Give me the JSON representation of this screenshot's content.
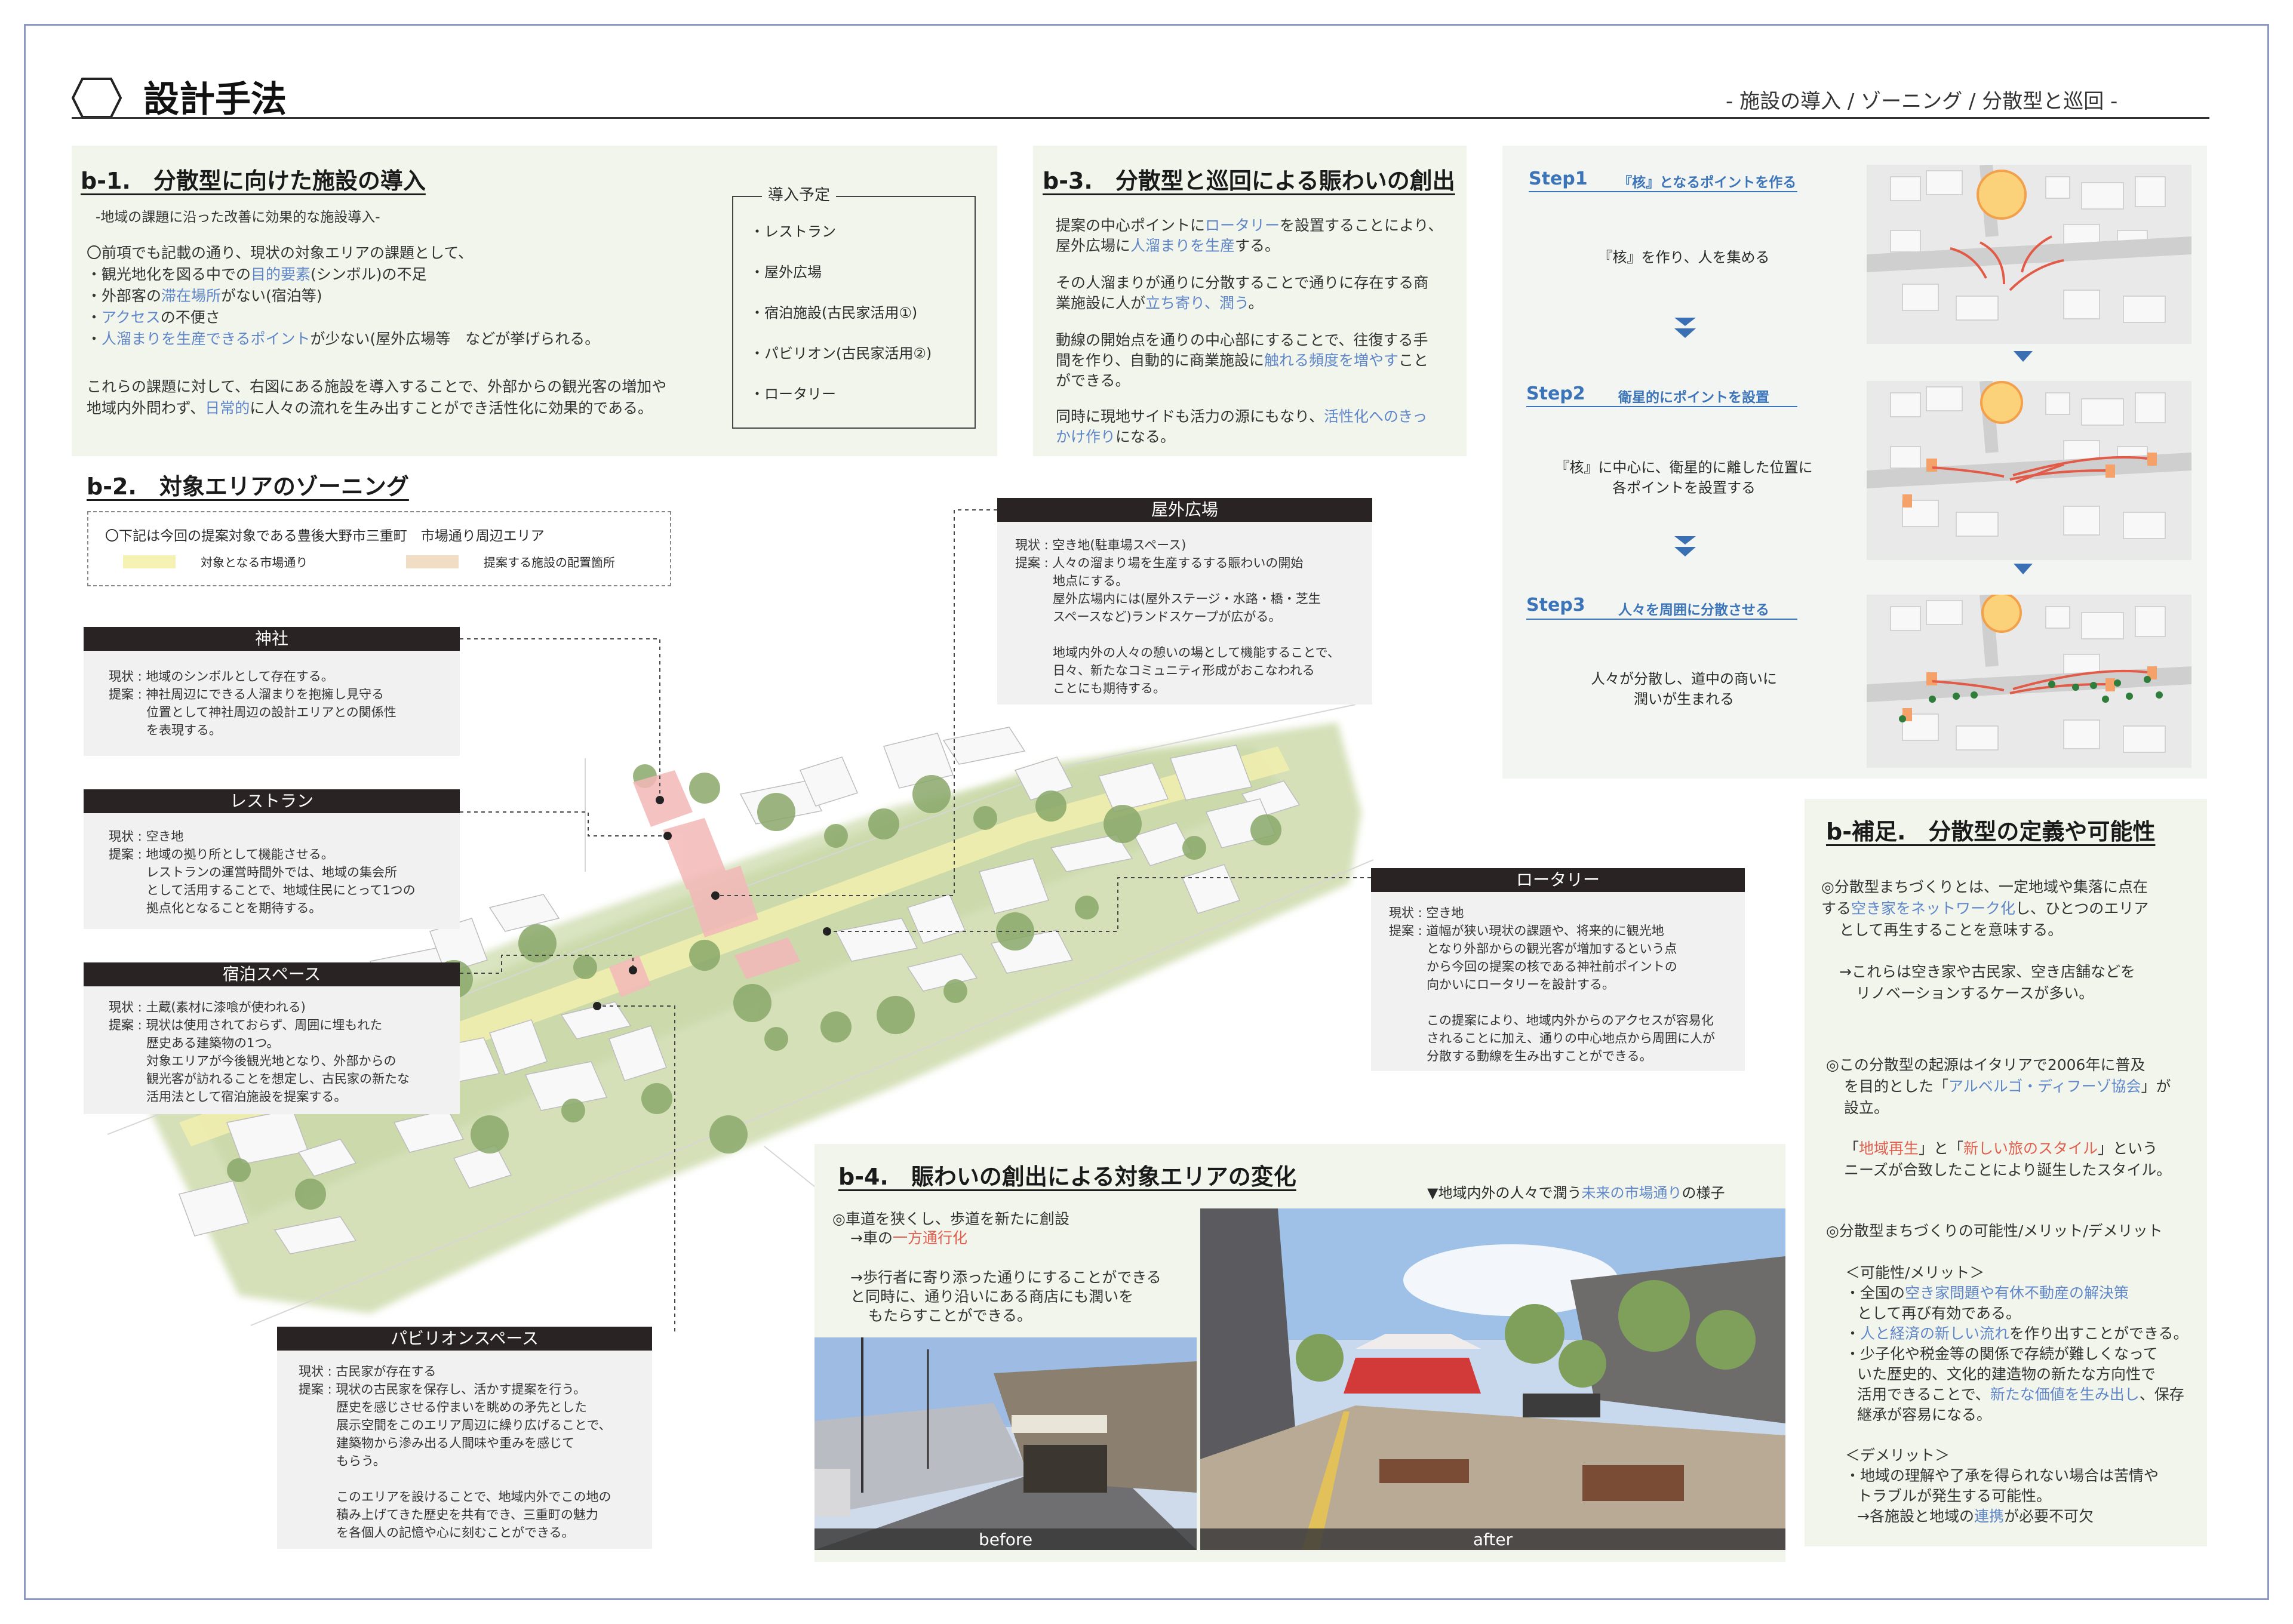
{
  "header": {
    "title": "設計手法",
    "subtitle": "- 施設の導入 / ゾーニング / 分散型と巡回 -"
  },
  "b1": {
    "heading": "b-1.　分散型に向けた施設の導入",
    "lead": "-地域の課題に沿った改善に効果的な施設導入-",
    "l1": "〇前項でも記載の通り、現状の対象エリアの課題として、",
    "l2a": "・観光地化を図る中での",
    "l2b": "目的要素",
    "l2c": "(シンボル)の不足",
    "l3a": "・外部客の",
    "l3b": "滞在場所",
    "l3c": "がない(宿泊等)",
    "l4a": "・",
    "l4b": "アクセス",
    "l4c": "の不便さ",
    "l5a": "・",
    "l5b": "人溜まりを生産できるポイント",
    "l5c": "が少ない(屋外広場等　などが挙げられる。",
    "l6": "これらの課題に対して、右図にある施設を導入することで、外部からの観光客の増加や",
    "l7a": "地域内外問わず、",
    "l7b": "日常的",
    "l7c": "に人々の流れを生み出すことができ活性化に効果的である。",
    "plan_title": "導入予定",
    "plan_items": [
      "・レストラン",
      "・屋外広場",
      "・宿泊施設(古民家活用①)",
      "・パビリオン(古民家活用②)",
      "・ロータリー"
    ]
  },
  "b2": {
    "heading": "b-2.　対象エリアのゾーニング",
    "legend_note": "〇下記は今回の提案対象である豊後大野市三重町　市場通り周辺エリア",
    "legend_street": "対象となる市場通り",
    "legend_facility": "提案する施設の配置箇所",
    "street_color": "#f5f2b4",
    "facility_color": "#f1dcc4"
  },
  "callouts": {
    "shrine": {
      "title": "神社",
      "text": "現状 : 地域のシンボルとして存在する。\n提案 : 神社周辺にできる人溜まりを抱擁し見守る\n　　　位置として神社周辺の設計エリアとの関係性\n　　　を表現する。"
    },
    "restaurant": {
      "title": "レストラン",
      "text": "現状 : 空き地\n提案 : 地域の拠り所として機能させる。\n　　　レストランの運営時間外では、地域の集会所\n　　　として活用することで、地域住民にとって1つの\n　　　拠点化となることを期待する。"
    },
    "lodging": {
      "title": "宿泊スペース",
      "text": "現状 : 土蔵(素材に漆喰が使われる)\n提案 : 現状は使用されておらず、周囲に埋もれた\n　　　歴史ある建築物の1つ。\n　　　対象エリアが今後観光地となり、外部からの\n　　　観光客が訪れることを想定し、古民家の新たな\n　　　活用法として宿泊施設を提案する。"
    },
    "plaza": {
      "title": "屋外広場",
      "text": "現状 : 空き地(駐車場スペース)\n提案 : 人々の溜まり場を生産するする賑わいの開始\n　　　地点にする。\n　　　屋外広場内には(屋外ステージ・水路・橋・芝生\n　　　スペースなど)ランドスケープが広がる。\n\n　　　地域内外の人々の憩いの場として機能することで、\n　　　日々、新たなコミュニティ形成がおこなわれる\n　　　ことにも期待する。"
    },
    "rotary": {
      "title": "ロータリー",
      "text": "現状 : 空き地\n提案 : 道幅が狭い現状の課題や、将来的に観光地\n　　　となり外部からの観光客が増加するという点\n　　　から今回の提案の核である神社前ポイントの\n　　　向かいにロータリーを設計する。\n\n　　　この提案により、地域内外からのアクセスが容易化\n　　　されることに加え、通りの中心地点から周囲に人が\n　　　分散する動線を生み出すことができる。"
    },
    "pavilion": {
      "title": "パビリオンスペース",
      "text": "現状 : 古民家が存在する\n提案 : 現状の古民家を保存し、活かす提案を行う。\n　　　歴史を感じさせる佇まいを眺めの矛先とした\n　　　展示空間をこのエリア周辺に繰り広げることで、\n　　　建築物から滲み出る人間味や重みを感じて\n　　　もらう。\n\n　　　このエリアを設けることで、地域内外でこの地の\n　　　積み上げてきた歴史を共有でき、三重町の魅力\n　　　を各個人の記憶や心に刻むことができる。"
    }
  },
  "b3": {
    "heading": "b-3.　分散型と巡回による賑わいの創出",
    "p1a": "提案の中心ポイントに",
    "p1b": "ロータリー",
    "p1c": "を設置することにより、",
    "p1d": "屋外広場に",
    "p1e": "人溜まりを生産",
    "p1f": "する。",
    "p2a": "その人溜まりが通りに分散することで通りに存在する商",
    "p2b": "業施設に人が",
    "p2c": "立ち寄り、潤う",
    "p2d": "。",
    "p3a": "動線の開始点を通りの中心部にすることで、往復する手",
    "p3b": "間を作り、自動的に商業施設に",
    "p3c": "触れる頻度を増やす",
    "p3d": "こと",
    "p3e": "ができる。",
    "p4a": "同時に現地サイドも活力の源にもなり、",
    "p4b": "活性化へのきっ",
    "p4c": "かけ作り",
    "p4d": "になる。"
  },
  "steps": [
    {
      "label": "Step1",
      "title": "『核』となるポイントを作る",
      "desc": "『核』を作り、人を集める"
    },
    {
      "label": "Step2",
      "title": "衛星的にポイントを設置",
      "desc": "『核』に中心に、衛星的に離した位置に\n各ポイントを設置する"
    },
    {
      "label": "Step3",
      "title": "人々を周囲に分散させる",
      "desc": "人々が分散し、道中の商いに\n潤いが生まれる"
    }
  ],
  "bsup": {
    "heading": "b-補足.　分散型の定義や可能性",
    "s1a": "◎分散型まちづくりとは、一定地域や集落に点在",
    "s1b": "する",
    "s1c": "空き家をネットワーク化",
    "s1d": "し、ひとつのエリア",
    "s1e": "として再生することを意味する。",
    "s2a": "→これらは空き家や古民家、空き店舗などを",
    "s2b": "リノベーションするケースが多い。",
    "s3a": "◎この分散型の起源はイタリアで2006年に普及",
    "s3b": "を目的とした「",
    "s3c": "アルベルゴ・ディフーゾ協会",
    "s3d": "」が",
    "s3e": "設立。",
    "s4a": "「",
    "s4b": "地域再生",
    "s4c": "」と「",
    "s4d": "新しい旅のスタイル",
    "s4e": "」という",
    "s4f": "ニーズが合致したことにより誕生したスタイル。",
    "s5": "◎分散型まちづくりの可能性/メリット/デメリット",
    "s6": "＜可能性/メリット＞",
    "s7a": "・全国の",
    "s7b": "空き家問題や有休不動産の解決策",
    "s8": "として再び有効である。",
    "s9a": "・",
    "s9b": "人と経済の新しい流れ",
    "s9c": "を作り出すことができる。",
    "s10": "・少子化や税金等の関係で存続が難しくなって",
    "s11": "いた歴史的、文化的建造物の新たな方向性で",
    "s12a": "活用できることで、",
    "s12b": "新たな価値を生み出し",
    "s12c": "、保存",
    "s13": "継承が容易になる。",
    "s14": "＜デメリット＞",
    "s15": "・地域の理解や了承を得られない場合は苦情や",
    "s16": "トラブルが発生する可能性。",
    "s17a": "→各施設と地域の",
    "s17b": "連携",
    "s17c": "が必要不可欠"
  },
  "b4": {
    "heading": "b-4.　賑わいの創出による対象エリアの変化",
    "caption_a": "▼地域内外の人々で潤う",
    "caption_b": "未来の市場通り",
    "caption_c": "の様子",
    "t1": "◎車道を狭くし、歩道を新たに創設",
    "t2a": "→車の",
    "t2b": "一方通行化",
    "t3": "→歩行者に寄り添った通りにすることができる",
    "t4": "と同時に、通り沿いにある商店にも潤いを",
    "t5": "もたらすことができる。",
    "before": "before",
    "after": "after"
  }
}
